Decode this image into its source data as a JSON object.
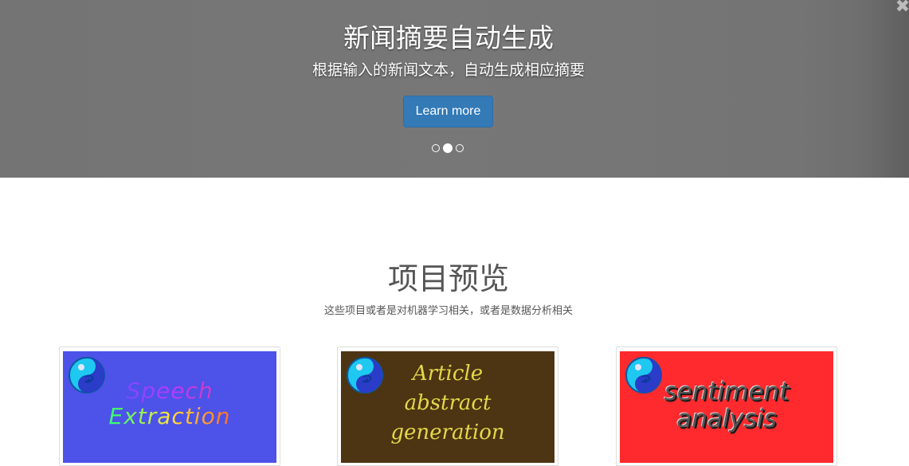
{
  "carousel": {
    "title": "新闻摘要自动生成",
    "subtitle": "根据输入的新闻文本，自动生成相应摘要",
    "button_label": "Learn more",
    "indicators": [
      {
        "active": false
      },
      {
        "active": true
      },
      {
        "active": false
      }
    ],
    "close_glyph": "✖"
  },
  "projects": {
    "title": "项目预览",
    "subtitle": "这些项目或者是对机器学习相关，或者是数据分析相关",
    "cards": [
      {
        "lines": [
          "Speech",
          "Extraction"
        ],
        "background": "#4d52e8",
        "icon": "yin-yang-logo-icon"
      },
      {
        "lines": [
          "Article",
          "abstract",
          "generation"
        ],
        "background": "#4d3412",
        "text_color": "#e2d84a",
        "icon": "yin-yang-logo-icon"
      },
      {
        "lines": [
          "sentiment",
          "analysis"
        ],
        "background": "#fe2a2e",
        "text_color": "#555555",
        "icon": "yin-yang-logo-icon"
      }
    ]
  }
}
